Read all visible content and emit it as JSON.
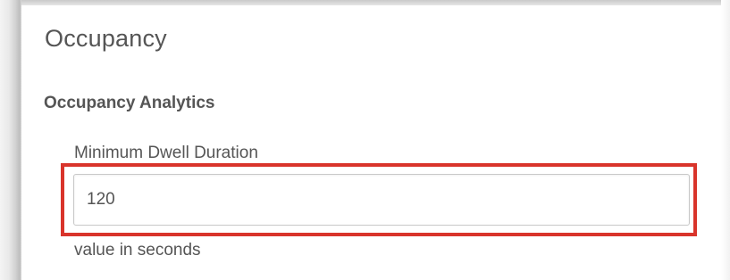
{
  "panel": {
    "title": "Occupancy",
    "section_title": "Occupancy Analytics",
    "field": {
      "label": "Minimum Dwell Duration",
      "value": "120",
      "help_text": "value in seconds"
    }
  },
  "colors": {
    "highlight": "#d9342b",
    "text": "#555555"
  }
}
